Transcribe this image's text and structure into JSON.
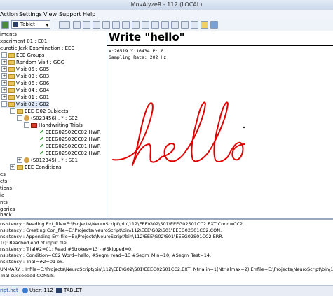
{
  "window": {
    "title": "MovAlyzeR - 112 (LOCAL)"
  },
  "menu": [
    "Action",
    "Settings",
    "View",
    "Support",
    "Help"
  ],
  "toolbar": {
    "tablet_label": "Tablet"
  },
  "tree": {
    "rows": [
      {
        "label": "iments"
      },
      {
        "label": "xperiment 01 : E01"
      },
      {
        "label": "eurotic Jerk Examination : EEE"
      },
      {
        "label": "EEE Groups"
      },
      {
        "label": "Random Visit : GGG"
      },
      {
        "label": "Visit 05 : G05"
      },
      {
        "label": "Visit 03 : G03"
      },
      {
        "label": "Visit 06 : G06"
      },
      {
        "label": "Visit 04 : G04"
      },
      {
        "label": "Visit 01 : G01"
      },
      {
        "label": "Visit 02 : G02"
      },
      {
        "label": "EEE-G02 Subjects"
      },
      {
        "label": "(S023456) , * : S02"
      },
      {
        "label": "Handwriting Trials"
      },
      {
        "label": "EEEG02S02CC02.HWR"
      },
      {
        "label": "EEEG02S02CC02.HWR"
      },
      {
        "label": "EEEG02S02CC01.HWR"
      },
      {
        "label": "EEEG02S02CC02.HWR"
      },
      {
        "label": "(S012345) , * : S01"
      },
      {
        "label": "EEE Conditions"
      },
      {
        "label": "es"
      },
      {
        "label": "cts"
      },
      {
        "label": "tions"
      },
      {
        "label": "ia"
      },
      {
        "label": "nts"
      },
      {
        "label": "gories"
      },
      {
        "label": "back"
      }
    ]
  },
  "canvas": {
    "title": "Write \"hello\"",
    "readout_coords": "X:26519 Y:16434 P:   0",
    "readout_rate": "Sampling Rate: 202 Hz",
    "ink_color": "#e00000"
  },
  "log": [
    "nsistency : Reading Ext_file=E:\\Projects\\NeuroScript\\bin\\112\\EEE\\G02\\S01\\EEEG02S01CC2.EXT Cond=CC2.",
    "nsistency : Creating Con_file=E:\\Projects\\NeuroScript\\bin\\112\\EEE\\G02\\S01\\EEEG02S01CC2.CON.",
    "nsistency : Appending Err_file=E:\\Projects\\NeuroScript\\bin\\112\\EEE\\G02\\S01\\EEEG02S01CC2.ERR.",
    "T(): Reached end of input file.",
    "nsistency : Trial#2=01: Read #Strokes=13 - #Skipped=0.",
    "nsistency : Condition=CC2 Word=hello, #Segm_read=13 #Segm_Min=10, #Segm_Test=14.",
    "nsistency : Trial=#2=01 ok.",
    "",
    "UMMARY: : Infile=E:\\Projects\\NeuroScript\\bin\\112\\EEE\\G02\\S01\\EEEG02S01CC2.EXT; Ntrialin=1(Ntrialmax=2) Errfile=E:\\Projects\\NeuroScript\\bin\\112\\EEE\\G02\\S01\\EEEG02S01CC2.ERR",
    "Trial succeeded CONSIS."
  ],
  "status": {
    "link": "ript.net",
    "user": "User: 112",
    "tablet": "TABLET"
  }
}
